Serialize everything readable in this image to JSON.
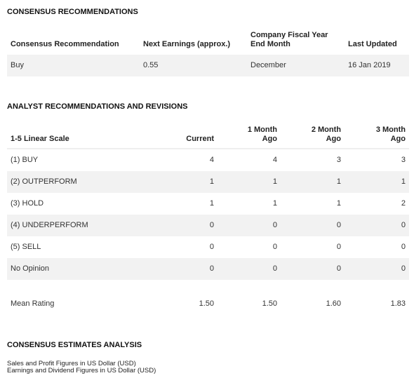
{
  "consensus": {
    "title": "CONSENSUS RECOMMENDATIONS",
    "headers": [
      "Consensus Recommendation",
      "Next Earnings (approx.)",
      "Company Fiscal Year",
      "End Month",
      "Last Updated"
    ],
    "row": [
      "Buy",
      "0.55",
      "December",
      "16 Jan 2019"
    ]
  },
  "analyst": {
    "title": "ANALYST RECOMMENDATIONS AND REVISIONS",
    "headers": {
      "scale": "1-5 Linear Scale",
      "current": "Current",
      "m1a": "1 Month",
      "m1b": "Ago",
      "m2a": "2 Month",
      "m2b": "Ago",
      "m3a": "3 Month",
      "m3b": "Ago"
    },
    "rows": [
      [
        "(1) BUY",
        "4",
        "4",
        "3",
        "3"
      ],
      [
        "(2) OUTPERFORM",
        "1",
        "1",
        "1",
        "1"
      ],
      [
        "(3) HOLD",
        "1",
        "1",
        "1",
        "2"
      ],
      [
        "(4) UNDERPERFORM",
        "0",
        "0",
        "0",
        "0"
      ],
      [
        "(5) SELL",
        "0",
        "0",
        "0",
        "0"
      ],
      [
        "No Opinion",
        "0",
        "0",
        "0",
        "0"
      ]
    ],
    "mean": [
      "Mean Rating",
      "1.50",
      "1.50",
      "1.60",
      "1.83"
    ]
  },
  "estimates": {
    "title": "CONSENSUS ESTIMATES ANALYSIS",
    "note1": "Sales and Profit Figures in US Dollar (USD)",
    "note2": "Earnings and Dividend Figures in US Dollar (USD)"
  }
}
